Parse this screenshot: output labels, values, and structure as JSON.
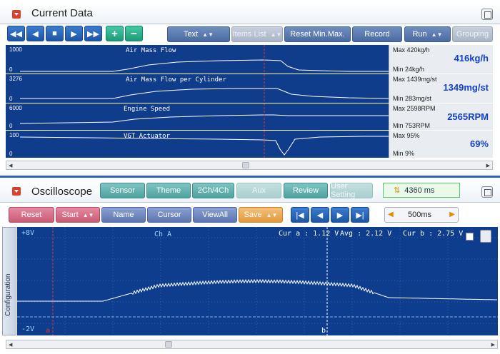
{
  "current_data": {
    "title": "Current Data",
    "toolbar": {
      "text": "Text",
      "items_list": "Items List",
      "reset_minmax": "Reset Min.Max.",
      "record": "Record",
      "run": "Run",
      "grouping": "Grouping"
    },
    "channels": [
      {
        "name": "Air Mass Flow",
        "axis_max": "1000",
        "axis_min": "0",
        "max": "Max  420kg/h",
        "min": "Min    24kg/h",
        "current": "416kg/h"
      },
      {
        "name": "Air Mass Flow per Cylinder",
        "axis_max": "3276",
        "axis_min": "0",
        "max": "Max  1439mg/st",
        "min": "Min    283mg/st",
        "current": "1349mg/st"
      },
      {
        "name": "Engine Speed",
        "axis_max": "6000",
        "axis_min": "0",
        "max": "Max  2598RPM",
        "min": "Min    753RPM",
        "current": "2565RPM"
      },
      {
        "name": "VGT Actuator",
        "axis_max": "100",
        "axis_min": "0",
        "max": "Max    95%",
        "min": "Min     9%",
        "current": "69%"
      }
    ]
  },
  "oscilloscope": {
    "title": "Oscilloscope",
    "tabs": {
      "sensor": "Sensor",
      "theme": "Theme",
      "ch": "2Ch/4Ch",
      "aux": "Aux",
      "review": "Review",
      "user_setting": "User Setting"
    },
    "time_readout": "4360 ms",
    "controls": {
      "reset": "Reset",
      "start": "Start",
      "name": "Name",
      "cursor": "Cursor",
      "view_all": "ViewAll",
      "save": "Save"
    },
    "timebase": "500ms",
    "config_label": "Configuration",
    "upper_label": "+8V",
    "lower_label": "-2V",
    "channel_label": "Ch A",
    "cursor_a_label": "a",
    "cursor_b_label": "b",
    "readouts": {
      "cur_a": "Cur a : 1.12 V",
      "avg": "Avg : 2.12 V",
      "cur_b": "Cur b : 2.75 V"
    }
  }
}
